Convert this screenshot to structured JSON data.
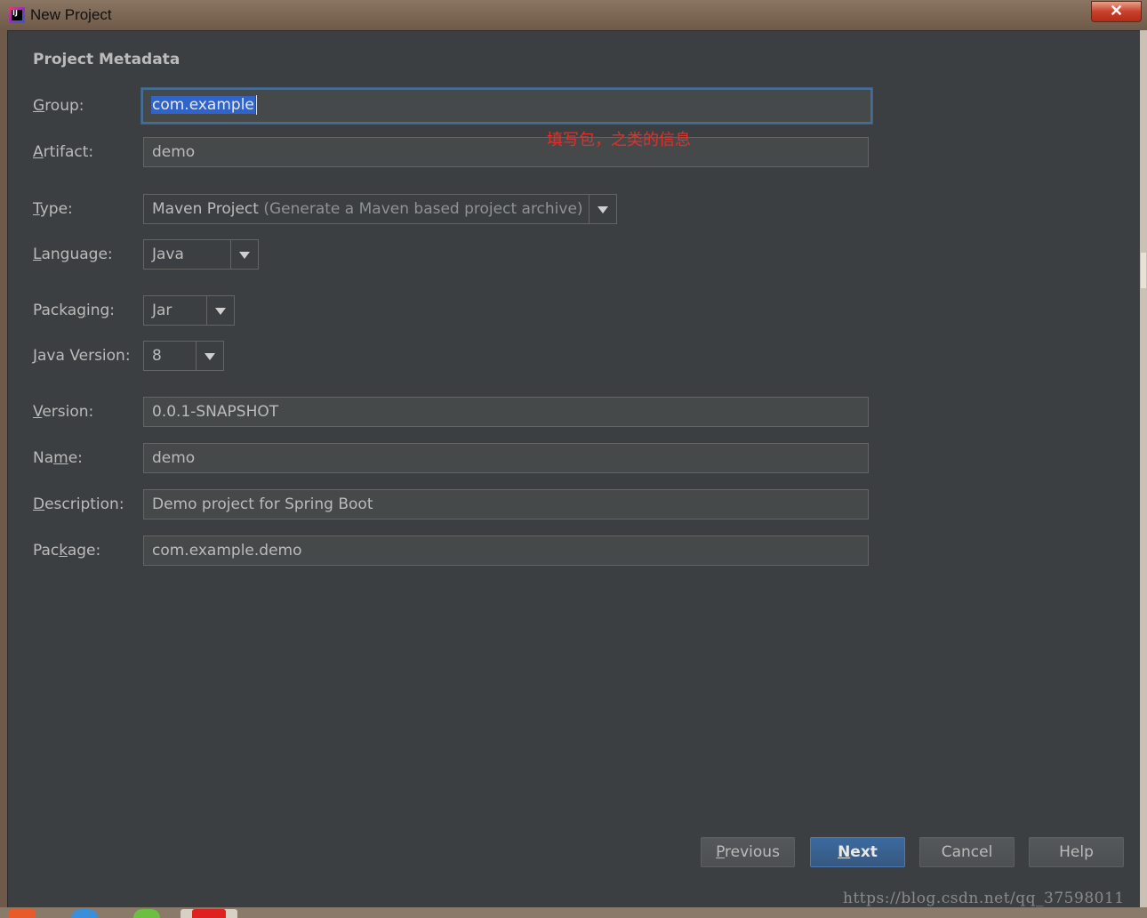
{
  "window": {
    "title": "New Project",
    "close_label": "✕"
  },
  "section": {
    "title": "Project Metadata"
  },
  "form": {
    "group": {
      "label_pre": "",
      "label_key": "G",
      "label_post": "roup:",
      "value": "com.example"
    },
    "artifact": {
      "label_pre": "",
      "label_key": "A",
      "label_post": "rtifact:",
      "value": "demo"
    },
    "type": {
      "label_pre": "",
      "label_key": "T",
      "label_post": "ype:",
      "value": "Maven Project",
      "hint": "(Generate a Maven based project archive)"
    },
    "language": {
      "label_pre": "",
      "label_key": "L",
      "label_post": "anguage:",
      "value": "Java"
    },
    "packaging": {
      "label_pre": "Packa",
      "label_key": "g",
      "label_post": "ing:",
      "value": "Jar"
    },
    "java_version": {
      "label_pre": "",
      "label_key": "J",
      "label_post": "ava Version:",
      "value": "8"
    },
    "version": {
      "label_pre": "",
      "label_key": "V",
      "label_post": "ersion:",
      "value": "0.0.1-SNAPSHOT"
    },
    "name": {
      "label_pre": "Na",
      "label_key": "m",
      "label_post": "e:",
      "value": "demo"
    },
    "description": {
      "label_pre": "",
      "label_key": "D",
      "label_post": "escription:",
      "value": "Demo project for Spring Boot"
    },
    "package": {
      "label_pre": "Pac",
      "label_key": "k",
      "label_post": "age:",
      "value": "com.example.demo"
    }
  },
  "annotation": "填写包，之类的信息",
  "buttons": {
    "previous": {
      "pre": "",
      "key": "P",
      "post": "revious"
    },
    "next": {
      "pre": "",
      "key": "N",
      "post": "ext"
    },
    "cancel": "Cancel",
    "help": "Help"
  },
  "watermark": "https://blog.csdn.net/qq_37598011",
  "colors": {
    "dialog_bg": "#3c3f41",
    "field_bg": "#45494a",
    "focus_border": "#466d94",
    "selection": "#2f65ca",
    "annotation": "#e0302a",
    "primary_button": "#365880"
  }
}
